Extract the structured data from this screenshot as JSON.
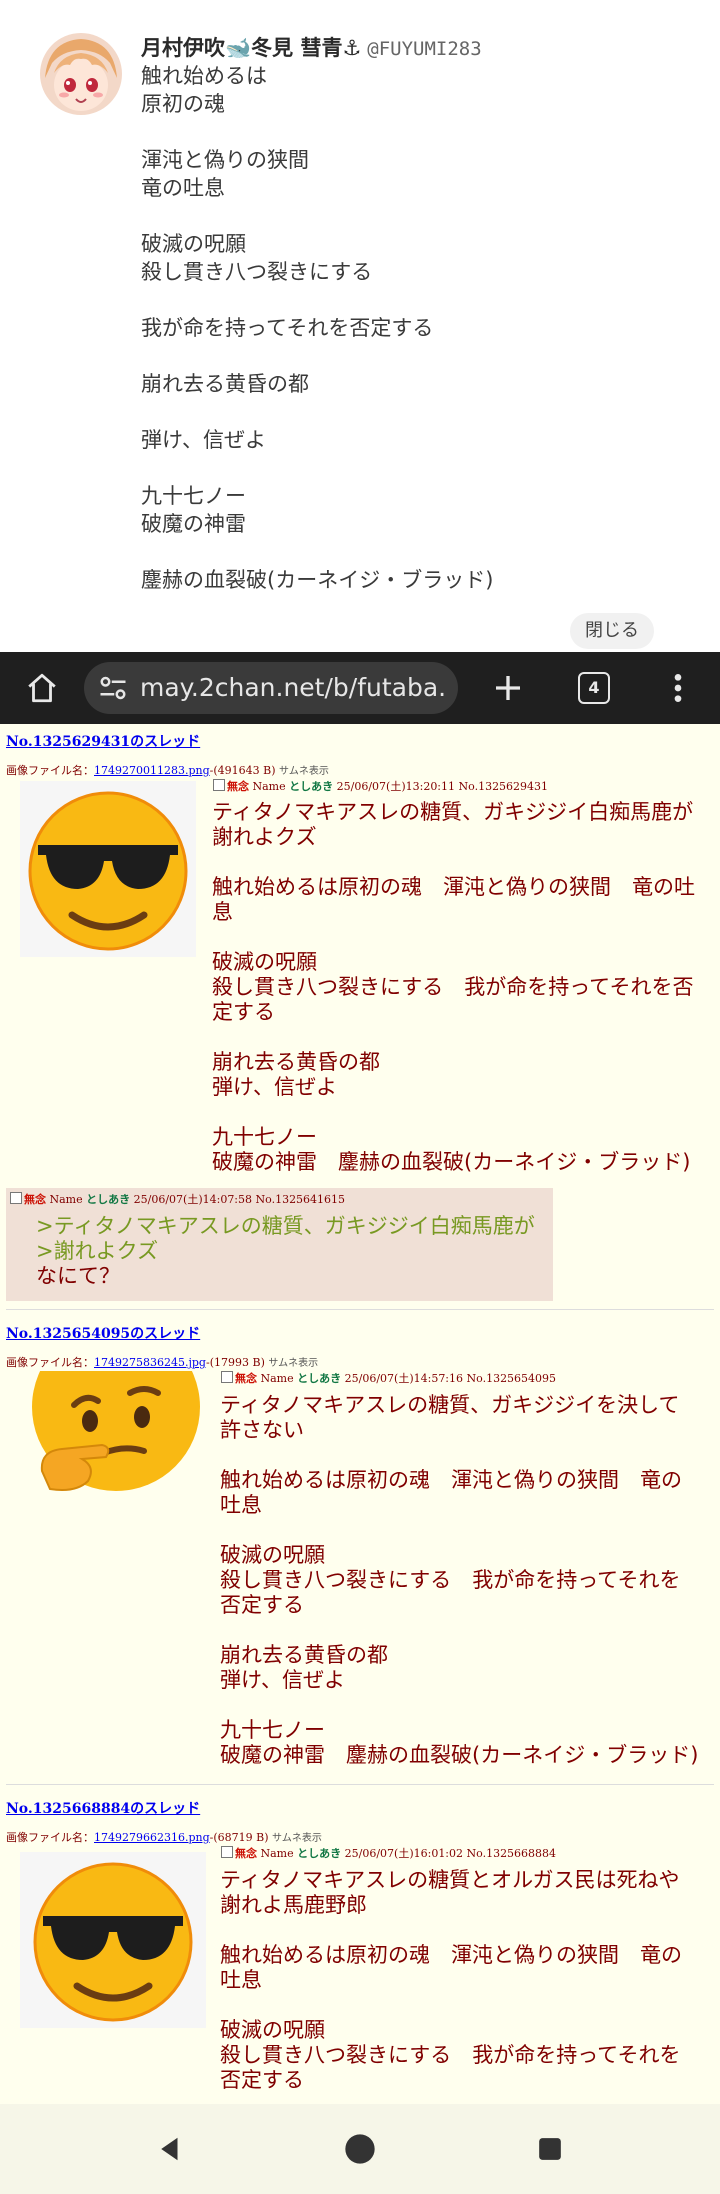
{
  "tweet": {
    "author_name": "月村伊吹🐋冬見 彗青⚓",
    "handle": "@FUYUMI283",
    "lines": [
      "触れ始めるは\n原初の魂",
      "渾沌と偽りの狭間\n竜の吐息",
      "破滅の呪願\n殺し貫き八つ裂きにする",
      "我が命を持ってそれを否定する",
      "崩れ去る黄昏の都",
      "弾け、信ぜよ",
      "九十七ノー\n破魔の神雷",
      "鏖赫の血裂破(カーネイジ・ブラッド)"
    ],
    "close_label": "閉じる"
  },
  "browser": {
    "url": "may.2chan.net/b/futaba.",
    "tab_count": "4",
    "icons": [
      "home-icon",
      "tune-icon",
      "plus-icon",
      "tabs-icon",
      "more-icon"
    ]
  },
  "threads": [
    {
      "link": "No.1325629431のスレッド",
      "file_label": "画像ファイル名：",
      "file_name": "1749270011283.png",
      "file_size": "-(491643 B)",
      "thumb_label": "サムネ表示",
      "subject": "無念",
      "name_label": "Name",
      "name": "としあき",
      "datetime": "25/06/07(土)13:20:11",
      "number": "No.1325629431",
      "emoji": "😎",
      "paragraphs": [
        "ティタノマキアスレの糖質、ガキジジイ白痴馬鹿が\n謝れよクズ",
        "触れ始めるは原初の魂　渾沌と偽りの狭間　竜の吐\n息",
        "破滅の呪願\n殺し貫き八つ裂きにする　我が命を持ってそれを否\n定する",
        "崩れ去る黄昏の都\n弾け、信ぜよ",
        "九十七ノー\n破魔の神雷　鏖赫の血裂破(カーネイジ・ブラッド)"
      ]
    },
    {
      "link": "No.1325654095のスレッド",
      "file_label": "画像ファイル名：",
      "file_name": "1749275836245.jpg",
      "file_size": "-(17993 B)",
      "thumb_label": "サムネ表示",
      "subject": "無念",
      "name_label": "Name",
      "name": "としあき",
      "datetime": "25/06/07(土)14:57:16",
      "number": "No.1325654095",
      "emoji": "🤔",
      "paragraphs": [
        "ティタノマキアスレの糖質、ガキジジイを決して\n許さない",
        "触れ始めるは原初の魂　渾沌と偽りの狭間　竜の\n吐息",
        "破滅の呪願\n殺し貫き八つ裂きにする　我が命を持ってそれを\n否定する",
        "崩れ去る黄昏の都\n弾け、信ぜよ",
        "九十七ノー\n破魔の神雷　鏖赫の血裂破(カーネイジ・ブラッド)"
      ]
    },
    {
      "link": "No.1325668884のスレッド",
      "file_label": "画像ファイル名：",
      "file_name": "1749279662316.png",
      "file_size": "-(68719 B)",
      "thumb_label": "サムネ表示",
      "subject": "無念",
      "name_label": "Name",
      "name": "としあき",
      "datetime": "25/06/07(土)16:01:02",
      "number": "No.1325668884",
      "emoji": "😎",
      "paragraphs": [
        "ティタノマキアスレの糖質とオルガス民は死ねや\n謝れよ馬鹿野郎",
        "触れ始めるは原初の魂　渾沌と偽りの狭間　竜の\n吐息",
        "破滅の呪願\n殺し貫き八つ裂きにする　我が命を持ってそれを\n否定する"
      ]
    }
  ],
  "reply": {
    "subject": "無念",
    "name_label": "Name",
    "name": "としあき",
    "datetime": "25/06/07(土)14:07:58",
    "number": "No.1325641615",
    "quote": ">ティタノマキアスレの糖質、ガキジジイ白痴馬鹿が\n>謝れよクズ",
    "text": "なにて？"
  },
  "navbar": {
    "icons": [
      "back-icon",
      "home-circle-icon",
      "recents-icon"
    ]
  },
  "colors": {
    "futaba_bg": "#ffffee",
    "post_text": "#800000",
    "subject": "#cc1105",
    "name": "#117743",
    "quote": "#789922",
    "reply_bg": "#f0e0d6",
    "link": "#0000ee"
  }
}
